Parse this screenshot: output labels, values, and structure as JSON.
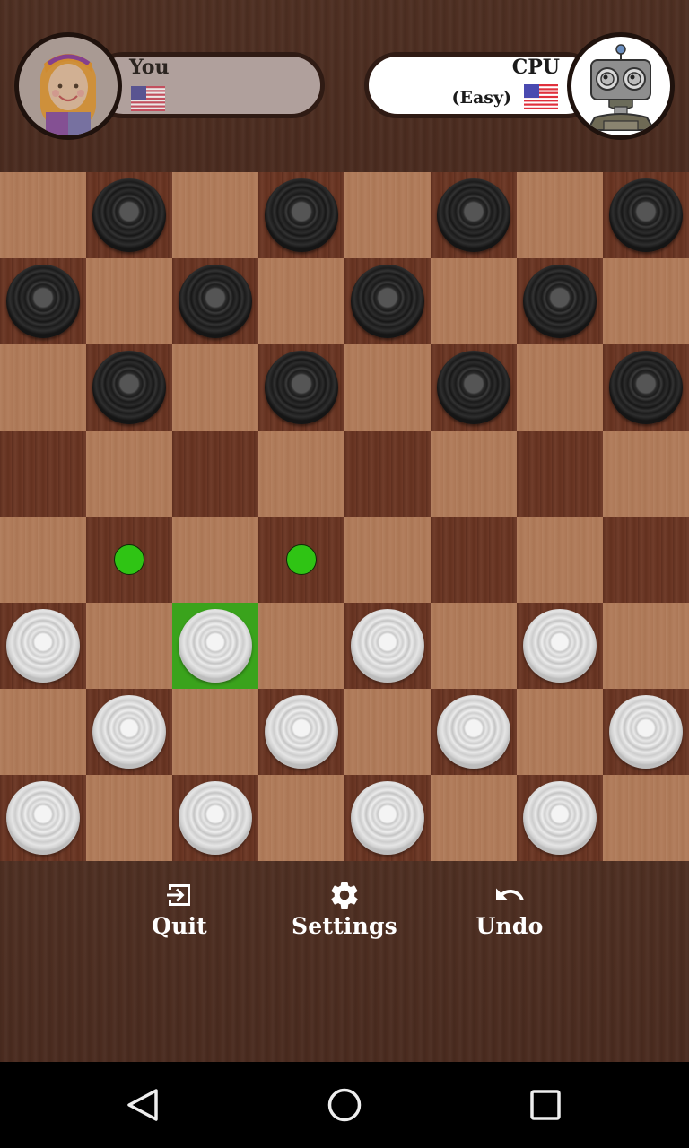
{
  "players": {
    "you": {
      "name": "You",
      "avatar_icon": "girl-avatar-icon",
      "flag_icon": "us-flag-icon"
    },
    "cpu": {
      "name": "CPU",
      "level": "(Easy)",
      "avatar_icon": "robot-avatar-icon",
      "flag_icon": "us-flag-icon"
    }
  },
  "colors": {
    "light_square": "#b07a58",
    "dark_square": "#6b3522",
    "selected_square": "#3aa31c",
    "move_hint": "#2fc414"
  },
  "board": {
    "size": 8,
    "rows": [
      [
        "",
        "b",
        "",
        "b",
        "",
        "b",
        "",
        "b"
      ],
      [
        "b",
        "",
        "b",
        "",
        "b",
        "",
        "b",
        ""
      ],
      [
        "",
        "b",
        "",
        "b",
        "",
        "b",
        "",
        "b"
      ],
      [
        "",
        "",
        "",
        "",
        "",
        "",
        "",
        ""
      ],
      [
        "",
        "h",
        "",
        "h",
        "",
        "",
        "",
        ""
      ],
      [
        "w",
        "",
        "W*",
        "",
        "w",
        "",
        "w",
        ""
      ],
      [
        "",
        "w",
        "",
        "w",
        "",
        "w",
        "",
        "w"
      ],
      [
        "w",
        "",
        "w",
        "",
        "w",
        "",
        "w",
        ""
      ]
    ],
    "legend": {
      "b": "black piece",
      "w": "white piece",
      "W*": "selected white piece",
      "h": "possible move"
    },
    "selected": {
      "row": 5,
      "col": 2
    },
    "possible_moves": [
      {
        "row": 4,
        "col": 1
      },
      {
        "row": 4,
        "col": 3
      }
    ]
  },
  "actions": {
    "quit": {
      "label": "Quit",
      "icon": "exit-icon"
    },
    "settings": {
      "label": "Settings",
      "icon": "gear-icon"
    },
    "undo": {
      "label": "Undo",
      "icon": "undo-icon"
    }
  },
  "nav": {
    "back": "back-icon",
    "home": "home-icon",
    "recents": "recents-icon"
  }
}
